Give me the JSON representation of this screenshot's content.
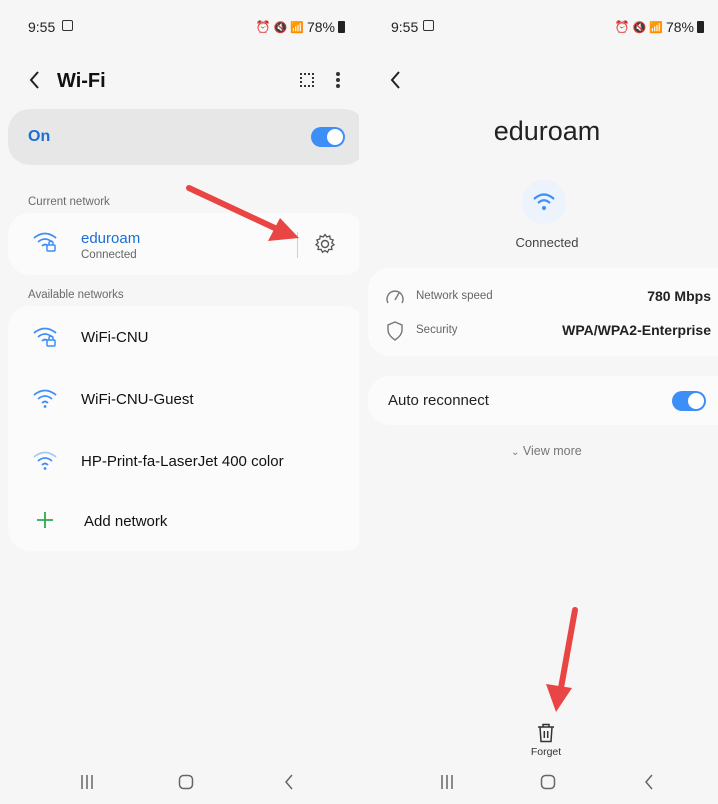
{
  "left": {
    "status": {
      "time": "9:55",
      "battery": "78%"
    },
    "header": {
      "title": "Wi-Fi"
    },
    "wifi_toggle": {
      "label": "On"
    },
    "current_section": {
      "label": "Current network"
    },
    "current_network": {
      "name": "eduroam",
      "status": "Connected"
    },
    "available_section": {
      "label": "Available networks"
    },
    "networks": [
      {
        "name": "WiFi-CNU",
        "icon": "wifi-lock-icon"
      },
      {
        "name": "WiFi-CNU-Guest",
        "icon": "wifi-icon"
      },
      {
        "name": "HP-Print-fa-LaserJet 400 color",
        "icon": "wifi-icon"
      }
    ],
    "add_network": {
      "label": "Add network"
    }
  },
  "right": {
    "status": {
      "time": "9:55",
      "battery": "78%"
    },
    "network": {
      "name": "eduroam",
      "status": "Connected"
    },
    "details": {
      "speed_label": "Network speed",
      "speed_value": "780 Mbps",
      "security_label": "Security",
      "security_value": "WPA/WPA2-Enterprise"
    },
    "auto_reconnect": {
      "label": "Auto reconnect"
    },
    "view_more": {
      "label": "View more"
    },
    "forget": {
      "label": "Forget"
    }
  },
  "colors": {
    "accent": "#3e8ef7",
    "link": "#1a6fd6",
    "arrow": "#ea4545",
    "add": "#2fa84f"
  }
}
